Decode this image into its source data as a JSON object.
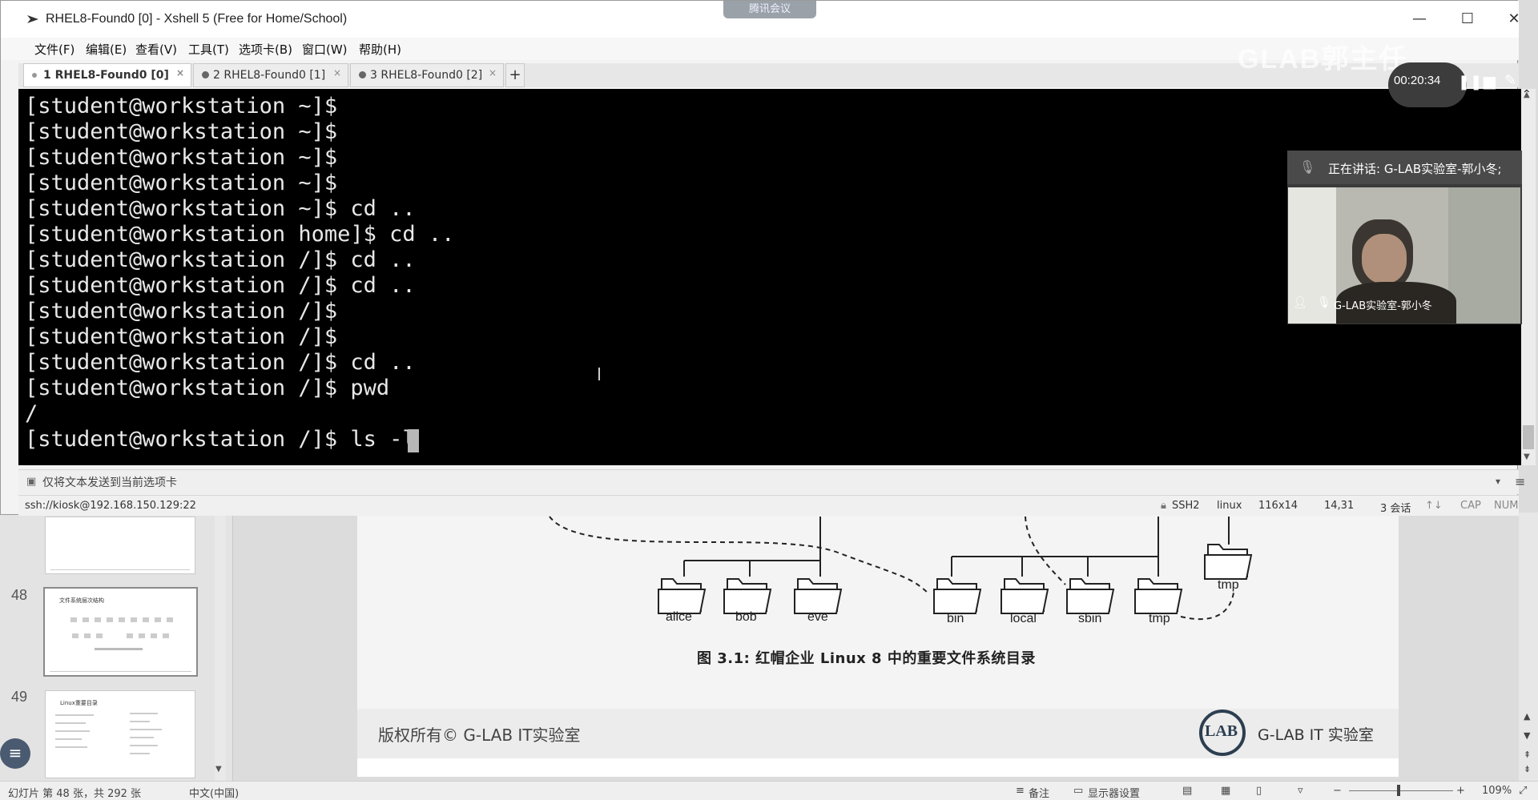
{
  "xshell": {
    "title": "RHEL8-Found0 [0] - Xshell 5 (Free for Home/School)",
    "menu": [
      "文件(F)",
      "编辑(E)",
      "查看(V)",
      "工具(T)",
      "选项卡(B)",
      "窗口(W)",
      "帮助(H)"
    ],
    "tabs": [
      {
        "label": "1 RHEL8-Found0 [0]",
        "active": true
      },
      {
        "label": "2 RHEL8-Found0 [1]",
        "active": false
      },
      {
        "label": "3 RHEL8-Found0 [2]",
        "active": false
      }
    ],
    "tab_add": "+",
    "terminal_lines": [
      "[student@workstation ~]$",
      "[student@workstation ~]$",
      "[student@workstation ~]$",
      "[student@workstation ~]$",
      "[student@workstation ~]$ cd ..",
      "[student@workstation home]$ cd ..",
      "[student@workstation /]$ cd ..",
      "[student@workstation /]$ cd ..",
      "[student@workstation /]$",
      "[student@workstation /]$",
      "[student@workstation /]$ cd ..",
      "[student@workstation /]$ pwd",
      "/",
      "[student@workstation /]$ ls -l"
    ],
    "compose_hint": "仅将文本发送到当前选项卡",
    "status": {
      "connection": "ssh://kiosk@192.168.150.129:22",
      "protocol": "SSH2",
      "term": "linux",
      "size": "116x14",
      "cursor_pos": "14,31",
      "sessions": "3 会话",
      "cap": "CAP",
      "num": "NUM"
    }
  },
  "meeting": {
    "app_tag": "腾讯会议",
    "watermark": "GLAB郭主任",
    "record_time": "00:20:34",
    "speaking": "正在讲话: G-LAB实验室-郭小冬;",
    "participant": "G-LAB实验室-郭小冬"
  },
  "presentation": {
    "slides": [
      {
        "number": "48",
        "title": "文件系统层次结构"
      },
      {
        "number": "49",
        "title": "Linux重要目录"
      }
    ],
    "figure_caption": "图 3.1: 红帽企业 Linux 8 中的重要文件系统目录",
    "folders": [
      "alice",
      "bob",
      "eve",
      "bin",
      "local",
      "sbin",
      "tmp",
      "tmp"
    ],
    "copyright": "版权所有© G-LAB IT实验室",
    "brand": "G-LAB IT 实验室",
    "logo": "LAB",
    "status": {
      "slide_info": "幻灯片 第 48 张，共 292 张",
      "language": "中文(中国)",
      "notes": "备注",
      "display_settings": "显示器设置",
      "zoom": "109%"
    }
  }
}
